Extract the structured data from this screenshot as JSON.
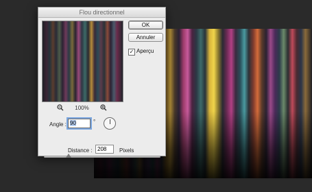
{
  "dialog": {
    "title": "Flou directionnel",
    "ok_label": "OK",
    "cancel_label": "Annuler",
    "preview_label": "Aperçu",
    "preview_checked": true,
    "zoom_level": "100%",
    "angle_label": "Angle :",
    "angle_value": "90",
    "degree_symbol": "°",
    "distance_label": "Distance :",
    "distance_value": "208",
    "distance_unit": "Pixels",
    "distance_slider_fraction": 0.21,
    "check_glyph": "✓"
  },
  "icons": {
    "zoom_out": "zoom-out-icon",
    "zoom_in": "zoom-in-icon",
    "angle_dial": "angle-dial-icon"
  },
  "colors": {
    "dialog_bg": "#ececec",
    "workspace_bg": "#2a2a2a",
    "focus_ring": "#7aa6e0"
  }
}
